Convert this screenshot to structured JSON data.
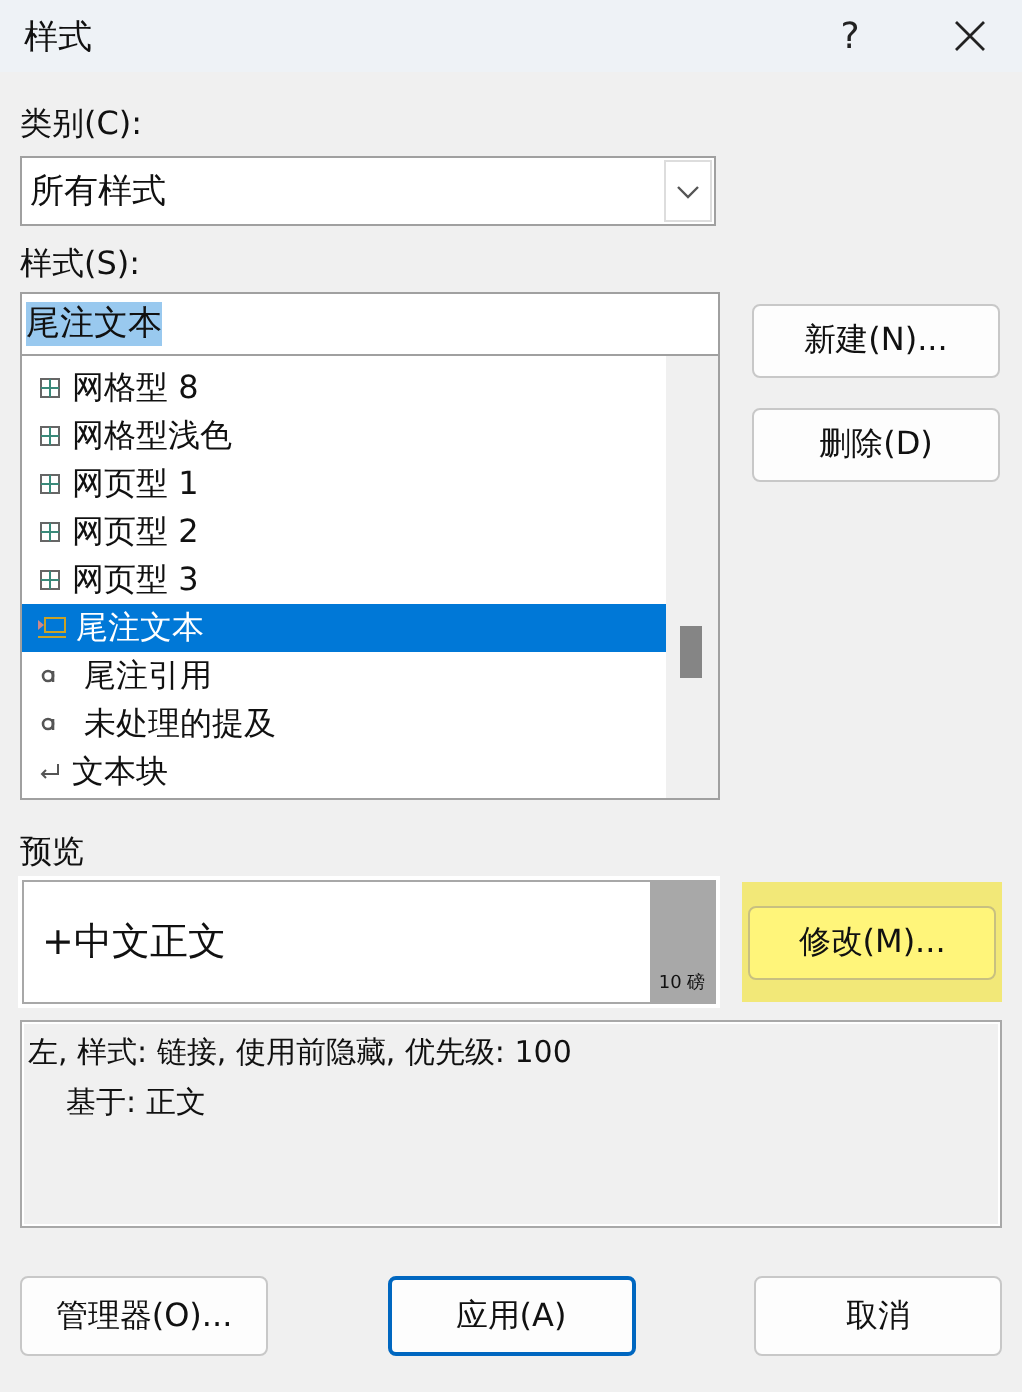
{
  "window": {
    "title": "样式",
    "help": "?"
  },
  "category": {
    "label": "类别(C):",
    "value": "所有样式"
  },
  "styles": {
    "label": "样式(S):",
    "value": "尾注文本",
    "items": [
      {
        "name": "网格型 8",
        "kind": "table",
        "selected": false
      },
      {
        "name": "网格型浅色",
        "kind": "table",
        "selected": false
      },
      {
        "name": "网页型 1",
        "kind": "table",
        "selected": false
      },
      {
        "name": "网页型 2",
        "kind": "table",
        "selected": false
      },
      {
        "name": "网页型 3",
        "kind": "table",
        "selected": false
      },
      {
        "name": "尾注文本",
        "kind": "linked",
        "selected": true
      },
      {
        "name": "尾注引用",
        "kind": "character",
        "selected": false
      },
      {
        "name": "未处理的提及",
        "kind": "character",
        "selected": false
      },
      {
        "name": "文本块",
        "kind": "paragraph",
        "selected": false
      }
    ]
  },
  "side_buttons": [
    {
      "label": "新建(N)...",
      "highlighted": false
    },
    {
      "label": "删除(D)",
      "highlighted": false
    }
  ],
  "preview": {
    "label": "预览",
    "sample": "+中文正文",
    "size": "10 磅"
  },
  "modify_button": {
    "label": "修改(M)...",
    "highlighted": true
  },
  "description": [
    "左, 样式: 链接, 使用前隐藏, 优先级: 100",
    "基于: 正文"
  ],
  "footer_buttons": [
    {
      "label": "管理器(O)...",
      "default": false
    },
    {
      "label": "应用(A)",
      "default": true
    },
    {
      "label": "取消",
      "default": false
    }
  ]
}
